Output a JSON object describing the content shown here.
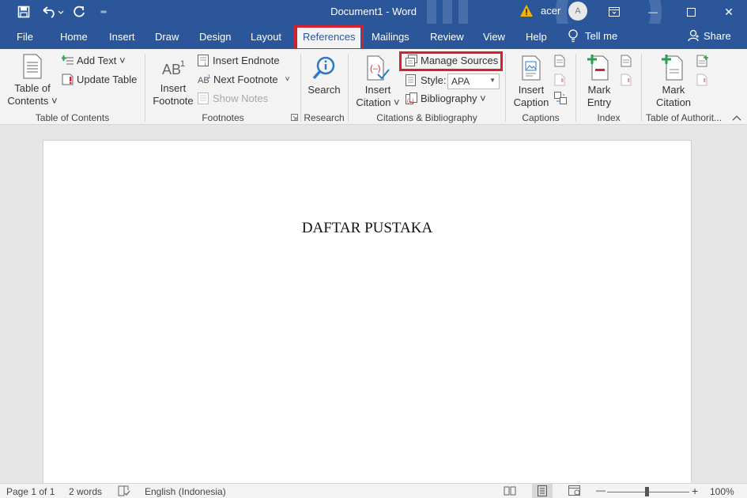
{
  "titlebar": {
    "document_title": "Document1  -  Word",
    "user_name": "acer",
    "avatar_initial": "A",
    "customize_glyph": "═",
    "minimize_glyph": "—",
    "close_glyph": "✕"
  },
  "tabs": {
    "file": "File",
    "home": "Home",
    "insert": "Insert",
    "draw": "Draw",
    "design": "Design",
    "layout": "Layout",
    "references": "References",
    "mailings": "Mailings",
    "review": "Review",
    "view": "View",
    "help": "Help",
    "tell_me": "Tell me",
    "share": "Share"
  },
  "ribbon": {
    "toc": {
      "table_of_contents": [
        "Table of",
        "Contents ˅"
      ],
      "add_text": "Add Text ˅",
      "update_table": "Update Table",
      "group_label": "Table of Contents"
    },
    "footnotes": {
      "insert_footnote": [
        "Insert",
        "Footnote"
      ],
      "insert_endnote": "Insert Endnote",
      "next_footnote": "Next Footnote",
      "next_footnote_arrow": "˅",
      "show_notes": "Show Notes",
      "group_label": "Footnotes"
    },
    "research": {
      "search": "Search",
      "group_label": "Research"
    },
    "citations": {
      "insert_citation": [
        "Insert",
        "Citation ˅"
      ],
      "manage_sources": "Manage Sources",
      "style_label": "Style:",
      "style_value": "APA",
      "bibliography": "Bibliography ˅",
      "group_label": "Citations & Bibliography"
    },
    "captions": {
      "insert_caption": [
        "Insert",
        "Caption"
      ],
      "group_label": "Captions"
    },
    "index": {
      "mark_entry": [
        "Mark",
        "Entry"
      ],
      "group_label": "Index"
    },
    "authorities": {
      "mark_citation": [
        "Mark",
        "Citation"
      ],
      "group_label": "Table of Authorit..."
    }
  },
  "document": {
    "heading": "DAFTAR PUSTAKA"
  },
  "status": {
    "page": "Page 1 of 1",
    "words": "2 words",
    "language": "English (Indonesia)",
    "zoom_minus": "—",
    "zoom_plus": "+",
    "zoom": "100%"
  },
  "colors": {
    "accent": "#2b579a",
    "highlight": "#d4202f",
    "ribbon_bg": "#f3f3f3",
    "canvas_bg": "#e6e6e6"
  }
}
